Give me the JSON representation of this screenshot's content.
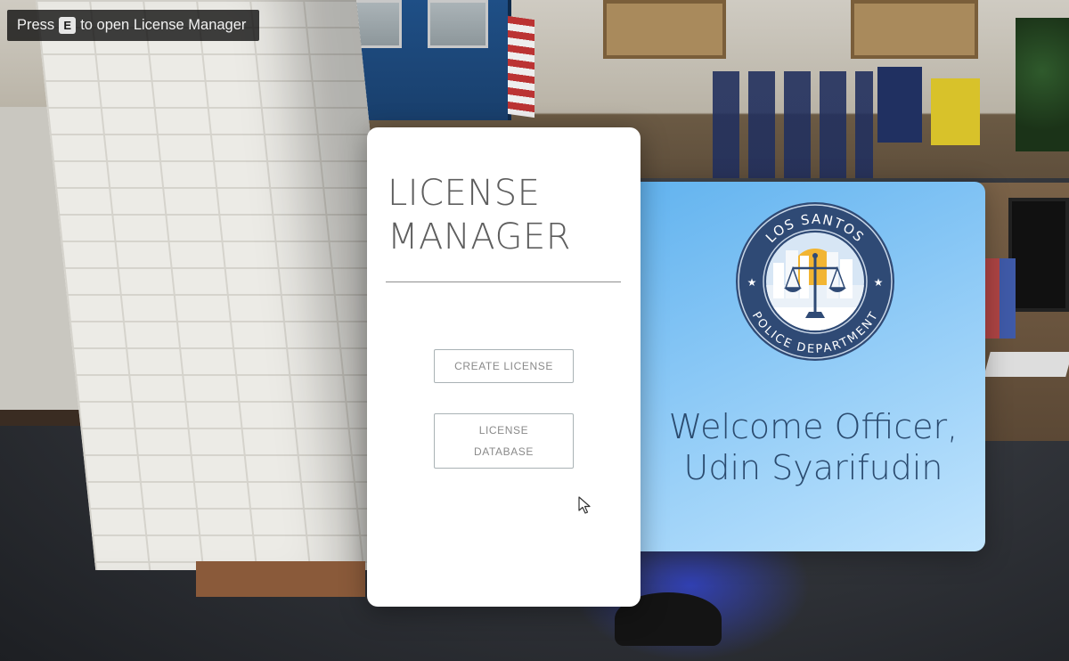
{
  "hint": {
    "prefix": "Press",
    "key": "E",
    "suffix": "to open License Manager"
  },
  "panel": {
    "title": "LICENSE\nMANAGER",
    "create_label": "CREATE LICENSE",
    "database_label": "LICENSE\nDATABASE"
  },
  "welcome": {
    "badge_top_text": "LOS SANTOS",
    "badge_bottom_text": "POLICE DEPARTMENT",
    "greeting_line1": "Welcome Officer,",
    "officer_name": "Udin Syarifudin"
  },
  "colors": {
    "panel_bg": "#ffffff",
    "welcome_gradient_start": "#62b3ef",
    "welcome_gradient_end": "#c0e4fd",
    "badge_ring": "#2f4a75",
    "button_border": "#a9b2b5"
  },
  "icons": {
    "key": "e-key-icon",
    "cursor": "mouse-pointer-icon",
    "badge": "lspd-badge-icon"
  }
}
